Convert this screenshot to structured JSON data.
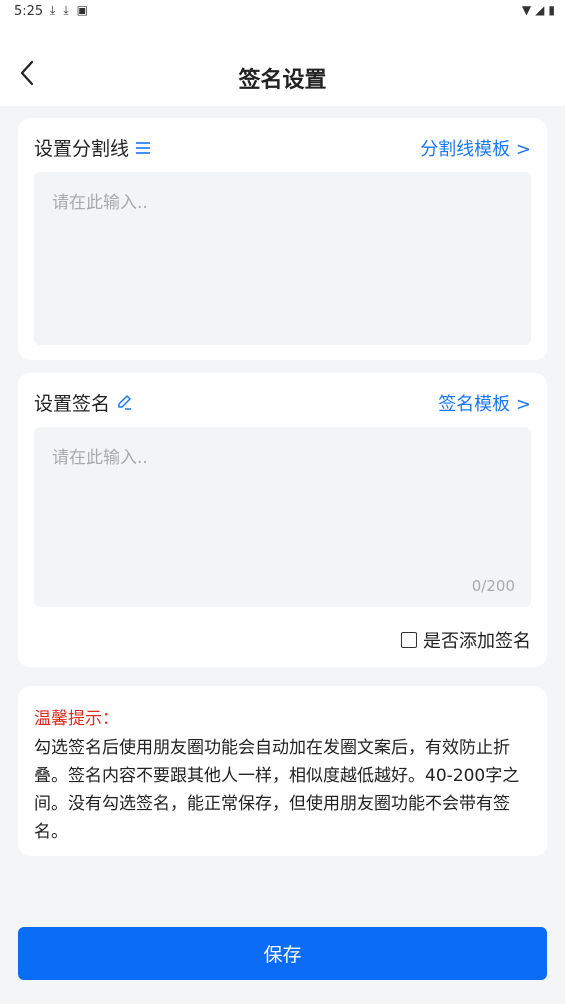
{
  "status_bar": {
    "time": "5:25"
  },
  "header": {
    "title": "签名设置"
  },
  "divider_card": {
    "label": "设置分割线",
    "template_link": "分割线模板 >",
    "placeholder": "请在此输入.."
  },
  "signature_card": {
    "label": "设置签名",
    "template_link": "签名模板 >",
    "placeholder": "请在此输入..",
    "counter": "0/200",
    "checkbox_label": "是否添加签名"
  },
  "tips": {
    "title": "温馨提示：",
    "text": "勾选签名后使用朋友圈功能会自动加在发圈文案后，有效防止折叠。签名内容不要跟其他人一样，相似度越低越好。40-200字之间。没有勾选签名，能正常保存，但使用朋友圈功能不会带有签名。"
  },
  "save_button": {
    "label": "保存"
  },
  "colors": {
    "accent": "#1677ff",
    "primary_button": "#0b6cf5",
    "warning": "#e02a1e",
    "background": "#f4f5f7"
  }
}
